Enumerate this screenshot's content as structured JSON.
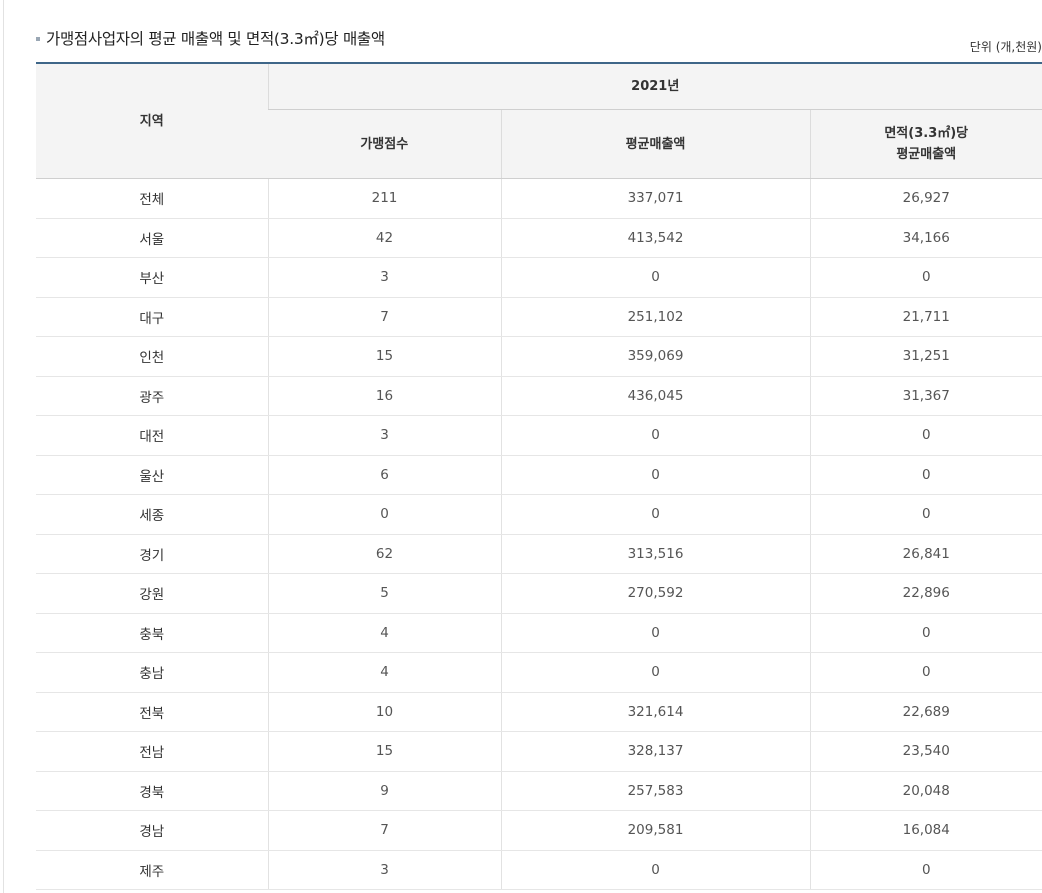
{
  "title": "가맹점사업자의 평균 매출액 및 면적(3.3㎡)당 매출액",
  "unit": "단위 (개,천원)",
  "table": {
    "region_header": "지역",
    "year_header": "2021년",
    "col_franchise_count": "가맹점수",
    "col_avg_sales": "평균매출액",
    "col_per_area_line1": "면적(3.3㎡)당",
    "col_per_area_line2": "평균매출액",
    "rows": [
      {
        "region": "전체",
        "count": "211",
        "avg_sales": "337,071",
        "per_area": "26,927"
      },
      {
        "region": "서울",
        "count": "42",
        "avg_sales": "413,542",
        "per_area": "34,166"
      },
      {
        "region": "부산",
        "count": "3",
        "avg_sales": "0",
        "per_area": "0"
      },
      {
        "region": "대구",
        "count": "7",
        "avg_sales": "251,102",
        "per_area": "21,711"
      },
      {
        "region": "인천",
        "count": "15",
        "avg_sales": "359,069",
        "per_area": "31,251"
      },
      {
        "region": "광주",
        "count": "16",
        "avg_sales": "436,045",
        "per_area": "31,367"
      },
      {
        "region": "대전",
        "count": "3",
        "avg_sales": "0",
        "per_area": "0"
      },
      {
        "region": "울산",
        "count": "6",
        "avg_sales": "0",
        "per_area": "0"
      },
      {
        "region": "세종",
        "count": "0",
        "avg_sales": "0",
        "per_area": "0"
      },
      {
        "region": "경기",
        "count": "62",
        "avg_sales": "313,516",
        "per_area": "26,841"
      },
      {
        "region": "강원",
        "count": "5",
        "avg_sales": "270,592",
        "per_area": "22,896"
      },
      {
        "region": "충북",
        "count": "4",
        "avg_sales": "0",
        "per_area": "0"
      },
      {
        "region": "충남",
        "count": "4",
        "avg_sales": "0",
        "per_area": "0"
      },
      {
        "region": "전북",
        "count": "10",
        "avg_sales": "321,614",
        "per_area": "22,689"
      },
      {
        "region": "전남",
        "count": "15",
        "avg_sales": "328,137",
        "per_area": "23,540"
      },
      {
        "region": "경북",
        "count": "9",
        "avg_sales": "257,583",
        "per_area": "20,048"
      },
      {
        "region": "경남",
        "count": "7",
        "avg_sales": "209,581",
        "per_area": "16,084"
      },
      {
        "region": "제주",
        "count": "3",
        "avg_sales": "0",
        "per_area": "0"
      }
    ]
  },
  "colors": {
    "header_top_border": "#3e6688",
    "header_background": "#f4f4f4",
    "title_bullet": "#9aa7b4"
  }
}
